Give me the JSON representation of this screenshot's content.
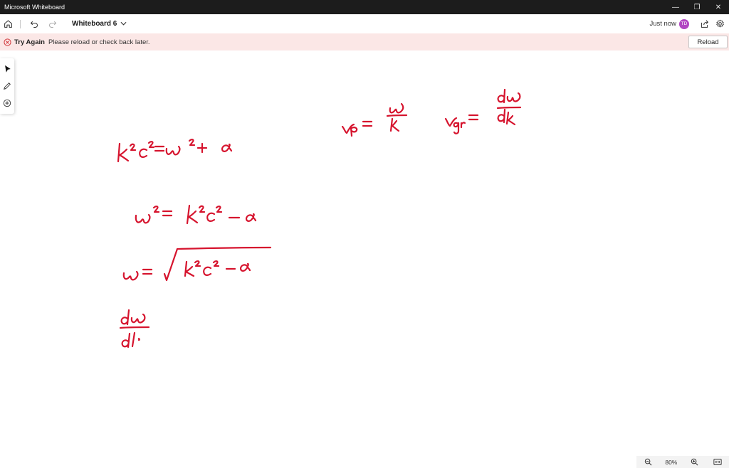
{
  "app": {
    "title": "Microsoft Whiteboard"
  },
  "window_controls": {
    "minimize": "—",
    "restore": "❐",
    "close": "✕"
  },
  "toolbar": {
    "board_name": "Whiteboard 6",
    "save_status": "Just now",
    "avatar_initials": "TD",
    "avatar_color": "#b146c2"
  },
  "banner": {
    "title": "Try Again",
    "message": "Please reload or check back later.",
    "reload_label": "Reload",
    "background": "#fbe7e6",
    "icon_color": "#d13438"
  },
  "zoom": {
    "level": "80%"
  },
  "ink": {
    "color": "#d6142e"
  }
}
